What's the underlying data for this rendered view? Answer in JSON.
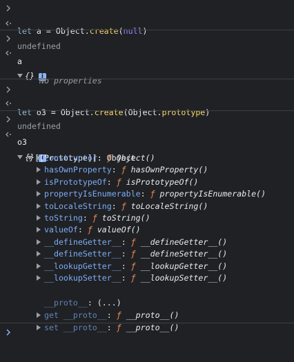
{
  "entries": {
    "cmd1": {
      "keyword": "let",
      "name": " a = ",
      "obj": "Object",
      "dot": ".",
      "method": "create",
      "open": "(",
      "arg": "null",
      "close": ")"
    },
    "res1": "undefined",
    "cmd2": "a",
    "res2": {
      "brace": "{}",
      "badge": "i",
      "empty": "No properties"
    },
    "cmd3": {
      "keyword": "let",
      "name": " o3 = ",
      "obj": "Object",
      "dot": ".",
      "method": "create",
      "open": "(",
      "arg_obj": "Object",
      "arg_dot": ".",
      "arg_prop": "prototype",
      "close": ")"
    },
    "res3": "undefined",
    "cmd4": "o3",
    "res4": {
      "brace": "{}",
      "badge": "i",
      "prototype_label": "[[Prototype]]: Object",
      "props": [
        {
          "key": "constructor",
          "value": "Object()"
        },
        {
          "key": "hasOwnProperty",
          "value": "hasOwnProperty()"
        },
        {
          "key": "isPrototypeOf",
          "value": "isPrototypeOf()"
        },
        {
          "key": "propertyIsEnumerable",
          "value": "propertyIsEnumerable()"
        },
        {
          "key": "toLocaleString",
          "value": "toLocaleString()"
        },
        {
          "key": "toString",
          "value": "toString()"
        },
        {
          "key": "valueOf",
          "value": "valueOf()"
        },
        {
          "key": "__defineGetter__",
          "value": "__defineGetter__()"
        },
        {
          "key": "__defineSetter__",
          "value": "__defineSetter__()"
        },
        {
          "key": "__lookupGetter__",
          "value": "__lookupGetter__()"
        },
        {
          "key": "__lookupSetter__",
          "value": "__lookupSetter__()"
        }
      ],
      "proto_getter": {
        "key": "__proto__",
        "value": "(...)"
      },
      "get_proto": {
        "prefix": "get ",
        "key": "__proto__",
        "value": "__proto__()"
      },
      "set_proto": {
        "prefix": "set ",
        "key": "__proto__",
        "value": "__proto__()"
      }
    }
  },
  "symbols": {
    "f": "ƒ",
    "colon": ": ",
    "prompt": "›",
    "result": "‹·"
  },
  "colors": {
    "background": "#202124",
    "separator": "#3c4043",
    "key": "#7cacf8",
    "function_symbol": "#f28b54",
    "keyword": "#9980ff",
    "badge": "#8ab4f8"
  }
}
